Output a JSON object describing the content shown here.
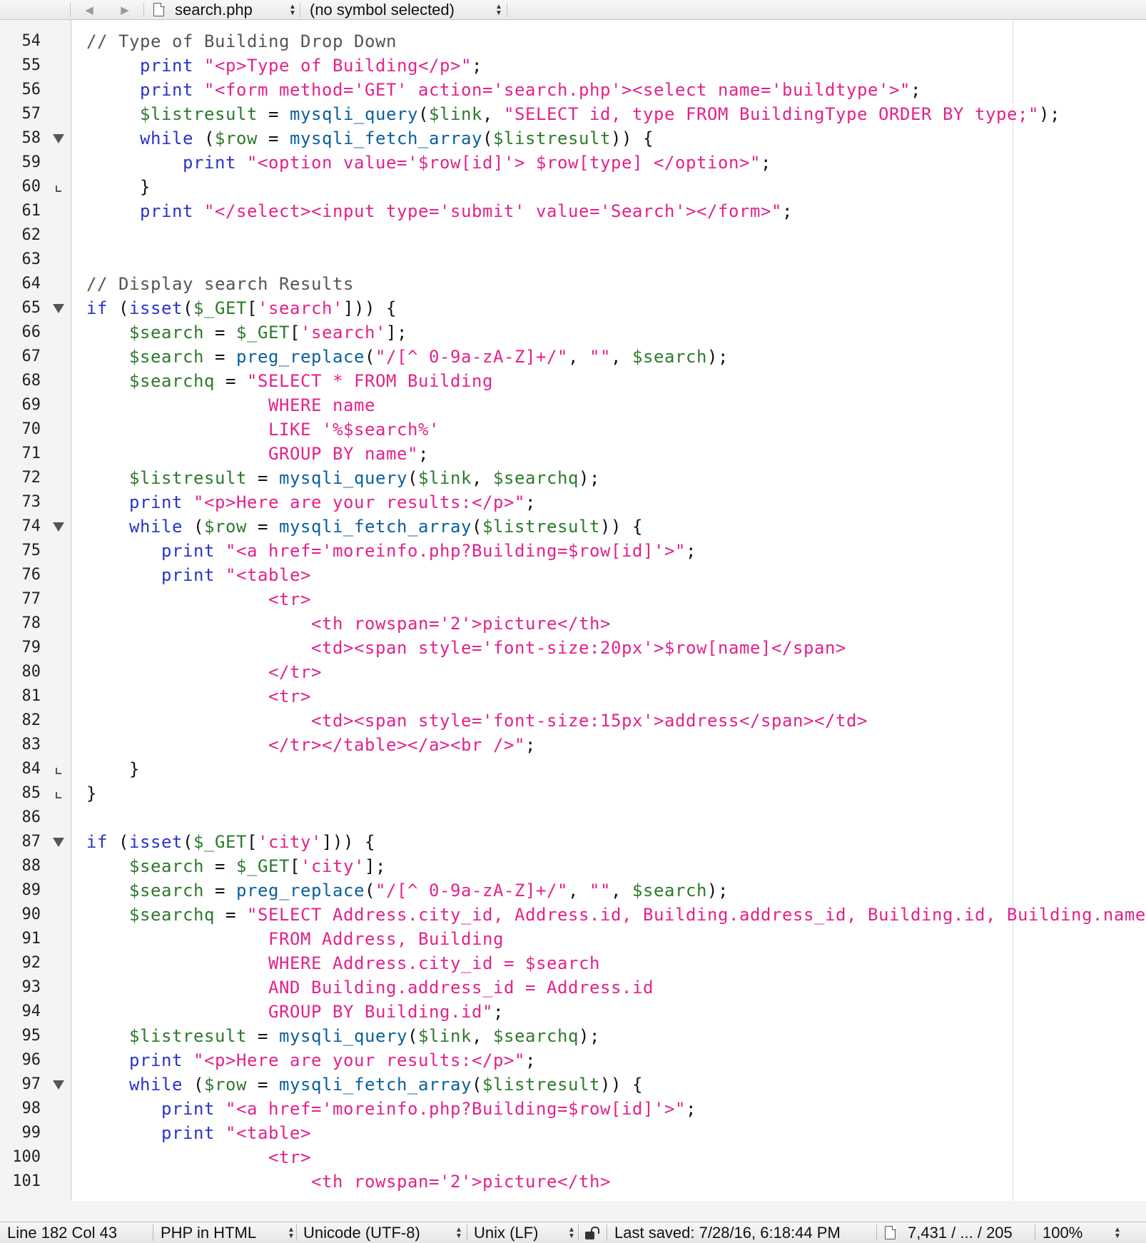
{
  "toolbar": {
    "back_glyph": "◀",
    "forward_glyph": "▶",
    "file_name": "search.php",
    "symbol_menu": "(no symbol selected)",
    "icons": [
      "back-arrow-icon",
      "forward-arrow-icon",
      "document-icon",
      "chevron-updown-icon"
    ]
  },
  "editor": {
    "lines": [
      {
        "num": "54",
        "fold": "",
        "tokens": [
          {
            "t": "// Type of Building Drop Down",
            "s": 5
          }
        ]
      },
      {
        "num": "55",
        "fold": "",
        "tokens": [
          {
            "t": "     ",
            "s": 0
          },
          {
            "t": "print",
            "s": 2
          },
          {
            "t": " ",
            "s": 0
          },
          {
            "t": "\"<p>Type of Building</p>\"",
            "s": 4
          },
          {
            "t": ";",
            "s": 0
          }
        ]
      },
      {
        "num": "56",
        "fold": "",
        "tokens": [
          {
            "t": "     ",
            "s": 0
          },
          {
            "t": "print",
            "s": 2
          },
          {
            "t": " ",
            "s": 0
          },
          {
            "t": "\"<form method='GET' action='search.php'><select name='buildtype'>\"",
            "s": 4
          },
          {
            "t": ";",
            "s": 0
          }
        ]
      },
      {
        "num": "57",
        "fold": "",
        "tokens": [
          {
            "t": "     ",
            "s": 0
          },
          {
            "t": "$listresult",
            "s": 3
          },
          {
            "t": " = ",
            "s": 0
          },
          {
            "t": "mysqli_query",
            "s": 1
          },
          {
            "t": "(",
            "s": 0
          },
          {
            "t": "$link",
            "s": 3
          },
          {
            "t": ", ",
            "s": 0
          },
          {
            "t": "\"SELECT id, type FROM BuildingType ORDER BY type;\"",
            "s": 4
          },
          {
            "t": ");",
            "s": 0
          }
        ]
      },
      {
        "num": "58",
        "fold": "open",
        "tokens": [
          {
            "t": "     ",
            "s": 0
          },
          {
            "t": "while",
            "s": 2
          },
          {
            "t": " (",
            "s": 0
          },
          {
            "t": "$row",
            "s": 3
          },
          {
            "t": " = ",
            "s": 0
          },
          {
            "t": "mysqli_fetch_array",
            "s": 1
          },
          {
            "t": "(",
            "s": 0
          },
          {
            "t": "$listresult",
            "s": 3
          },
          {
            "t": ")) {",
            "s": 0
          }
        ]
      },
      {
        "num": "59",
        "fold": "",
        "tokens": [
          {
            "t": "         ",
            "s": 0
          },
          {
            "t": "print",
            "s": 2
          },
          {
            "t": " ",
            "s": 0
          },
          {
            "t": "\"<option value='$row[id]'> $row[type] </option>\"",
            "s": 4
          },
          {
            "t": ";",
            "s": 0
          }
        ]
      },
      {
        "num": "60",
        "fold": "close",
        "tokens": [
          {
            "t": "     }",
            "s": 0
          }
        ]
      },
      {
        "num": "61",
        "fold": "",
        "tokens": [
          {
            "t": "     ",
            "s": 0
          },
          {
            "t": "print",
            "s": 2
          },
          {
            "t": " ",
            "s": 0
          },
          {
            "t": "\"</select><input type='submit' value='Search'></form>\"",
            "s": 4
          },
          {
            "t": ";",
            "s": 0
          }
        ]
      },
      {
        "num": "62",
        "fold": "",
        "tokens": []
      },
      {
        "num": "63",
        "fold": "",
        "tokens": []
      },
      {
        "num": "64",
        "fold": "",
        "tokens": [
          {
            "t": "// Display search Results",
            "s": 5
          }
        ]
      },
      {
        "num": "65",
        "fold": "open",
        "tokens": [
          {
            "t": "if",
            "s": 2
          },
          {
            "t": " (",
            "s": 0
          },
          {
            "t": "isset",
            "s": 2
          },
          {
            "t": "(",
            "s": 0
          },
          {
            "t": "$_GET",
            "s": 3
          },
          {
            "t": "[",
            "s": 0
          },
          {
            "t": "'search'",
            "s": 4
          },
          {
            "t": "])) {",
            "s": 0
          }
        ]
      },
      {
        "num": "66",
        "fold": "",
        "tokens": [
          {
            "t": "    ",
            "s": 0
          },
          {
            "t": "$search",
            "s": 3
          },
          {
            "t": " = ",
            "s": 0
          },
          {
            "t": "$_GET",
            "s": 3
          },
          {
            "t": "[",
            "s": 0
          },
          {
            "t": "'search'",
            "s": 4
          },
          {
            "t": "];",
            "s": 0
          }
        ]
      },
      {
        "num": "67",
        "fold": "",
        "tokens": [
          {
            "t": "    ",
            "s": 0
          },
          {
            "t": "$search",
            "s": 3
          },
          {
            "t": " = ",
            "s": 0
          },
          {
            "t": "preg_replace",
            "s": 1
          },
          {
            "t": "(",
            "s": 0
          },
          {
            "t": "\"/[^ 0-9a-zA-Z]+/\"",
            "s": 4
          },
          {
            "t": ", ",
            "s": 0
          },
          {
            "t": "\"\"",
            "s": 4
          },
          {
            "t": ", ",
            "s": 0
          },
          {
            "t": "$search",
            "s": 3
          },
          {
            "t": ");",
            "s": 0
          }
        ]
      },
      {
        "num": "68",
        "fold": "",
        "tokens": [
          {
            "t": "    ",
            "s": 0
          },
          {
            "t": "$searchq",
            "s": 3
          },
          {
            "t": " = ",
            "s": 0
          },
          {
            "t": "\"SELECT * FROM Building",
            "s": 4
          }
        ]
      },
      {
        "num": "69",
        "fold": "",
        "tokens": [
          {
            "t": "                 WHERE name",
            "s": 4
          }
        ]
      },
      {
        "num": "70",
        "fold": "",
        "tokens": [
          {
            "t": "                 LIKE '%$search%'",
            "s": 4
          }
        ]
      },
      {
        "num": "71",
        "fold": "",
        "tokens": [
          {
            "t": "                 GROUP BY name\"",
            "s": 4
          },
          {
            "t": ";",
            "s": 0
          }
        ]
      },
      {
        "num": "72",
        "fold": "",
        "tokens": [
          {
            "t": "    ",
            "s": 0
          },
          {
            "t": "$listresult",
            "s": 3
          },
          {
            "t": " = ",
            "s": 0
          },
          {
            "t": "mysqli_query",
            "s": 1
          },
          {
            "t": "(",
            "s": 0
          },
          {
            "t": "$link",
            "s": 3
          },
          {
            "t": ", ",
            "s": 0
          },
          {
            "t": "$searchq",
            "s": 3
          },
          {
            "t": ");",
            "s": 0
          }
        ]
      },
      {
        "num": "73",
        "fold": "",
        "tokens": [
          {
            "t": "    ",
            "s": 0
          },
          {
            "t": "print",
            "s": 2
          },
          {
            "t": " ",
            "s": 0
          },
          {
            "t": "\"<p>Here are your results:</p>\"",
            "s": 4
          },
          {
            "t": ";",
            "s": 0
          }
        ]
      },
      {
        "num": "74",
        "fold": "open",
        "tokens": [
          {
            "t": "    ",
            "s": 0
          },
          {
            "t": "while",
            "s": 2
          },
          {
            "t": " (",
            "s": 0
          },
          {
            "t": "$row",
            "s": 3
          },
          {
            "t": " = ",
            "s": 0
          },
          {
            "t": "mysqli_fetch_array",
            "s": 1
          },
          {
            "t": "(",
            "s": 0
          },
          {
            "t": "$listresult",
            "s": 3
          },
          {
            "t": ")) {",
            "s": 0
          }
        ]
      },
      {
        "num": "75",
        "fold": "",
        "tokens": [
          {
            "t": "       ",
            "s": 0
          },
          {
            "t": "print",
            "s": 2
          },
          {
            "t": " ",
            "s": 0
          },
          {
            "t": "\"<a href='moreinfo.php?Building=$row[id]'>\"",
            "s": 4
          },
          {
            "t": ";",
            "s": 0
          }
        ]
      },
      {
        "num": "76",
        "fold": "",
        "tokens": [
          {
            "t": "       ",
            "s": 0
          },
          {
            "t": "print",
            "s": 2
          },
          {
            "t": " ",
            "s": 0
          },
          {
            "t": "\"<table>",
            "s": 4
          }
        ]
      },
      {
        "num": "77",
        "fold": "",
        "tokens": [
          {
            "t": "                 <tr>",
            "s": 4
          }
        ]
      },
      {
        "num": "78",
        "fold": "",
        "tokens": [
          {
            "t": "                     <th rowspan='2'>picture</th>",
            "s": 4
          }
        ]
      },
      {
        "num": "79",
        "fold": "",
        "tokens": [
          {
            "t": "                     <td><span style='font-size:20px'>$row[name]</span>",
            "s": 4
          }
        ]
      },
      {
        "num": "80",
        "fold": "",
        "tokens": [
          {
            "t": "                 </tr>",
            "s": 4
          }
        ]
      },
      {
        "num": "81",
        "fold": "",
        "tokens": [
          {
            "t": "                 <tr>",
            "s": 4
          }
        ]
      },
      {
        "num": "82",
        "fold": "",
        "tokens": [
          {
            "t": "                     <td><span style='font-size:15px'>address</span></td>",
            "s": 4
          }
        ]
      },
      {
        "num": "83",
        "fold": "",
        "tokens": [
          {
            "t": "                 </tr></table></a><br />\"",
            "s": 4
          },
          {
            "t": ";",
            "s": 0
          }
        ]
      },
      {
        "num": "84",
        "fold": "close",
        "tokens": [
          {
            "t": "    }",
            "s": 0
          }
        ]
      },
      {
        "num": "85",
        "fold": "close",
        "tokens": [
          {
            "t": "}",
            "s": 0
          }
        ]
      },
      {
        "num": "86",
        "fold": "",
        "tokens": []
      },
      {
        "num": "87",
        "fold": "open",
        "tokens": [
          {
            "t": "if",
            "s": 2
          },
          {
            "t": " (",
            "s": 0
          },
          {
            "t": "isset",
            "s": 2
          },
          {
            "t": "(",
            "s": 0
          },
          {
            "t": "$_GET",
            "s": 3
          },
          {
            "t": "[",
            "s": 0
          },
          {
            "t": "'city'",
            "s": 4
          },
          {
            "t": "])) {",
            "s": 0
          }
        ]
      },
      {
        "num": "88",
        "fold": "",
        "tokens": [
          {
            "t": "    ",
            "s": 0
          },
          {
            "t": "$search",
            "s": 3
          },
          {
            "t": " = ",
            "s": 0
          },
          {
            "t": "$_GET",
            "s": 3
          },
          {
            "t": "[",
            "s": 0
          },
          {
            "t": "'city'",
            "s": 4
          },
          {
            "t": "];",
            "s": 0
          }
        ]
      },
      {
        "num": "89",
        "fold": "",
        "tokens": [
          {
            "t": "    ",
            "s": 0
          },
          {
            "t": "$search",
            "s": 3
          },
          {
            "t": " = ",
            "s": 0
          },
          {
            "t": "preg_replace",
            "s": 1
          },
          {
            "t": "(",
            "s": 0
          },
          {
            "t": "\"/[^ 0-9a-zA-Z]+/\"",
            "s": 4
          },
          {
            "t": ", ",
            "s": 0
          },
          {
            "t": "\"\"",
            "s": 4
          },
          {
            "t": ", ",
            "s": 0
          },
          {
            "t": "$search",
            "s": 3
          },
          {
            "t": ");",
            "s": 0
          }
        ]
      },
      {
        "num": "90",
        "fold": "",
        "tokens": [
          {
            "t": "    ",
            "s": 0
          },
          {
            "t": "$searchq",
            "s": 3
          },
          {
            "t": " = ",
            "s": 0
          },
          {
            "t": "\"SELECT Address.city_id, Address.id, Building.address_id, Building.id, Building.name",
            "s": 4
          }
        ]
      },
      {
        "num": "91",
        "fold": "",
        "tokens": [
          {
            "t": "                 FROM Address, Building",
            "s": 4
          }
        ]
      },
      {
        "num": "92",
        "fold": "",
        "tokens": [
          {
            "t": "                 WHERE Address.city_id = $search",
            "s": 4
          }
        ]
      },
      {
        "num": "93",
        "fold": "",
        "tokens": [
          {
            "t": "                 AND Building.address_id = Address.id",
            "s": 4
          }
        ]
      },
      {
        "num": "94",
        "fold": "",
        "tokens": [
          {
            "t": "                 GROUP BY Building.id\"",
            "s": 4
          },
          {
            "t": ";",
            "s": 0
          }
        ]
      },
      {
        "num": "95",
        "fold": "",
        "tokens": [
          {
            "t": "    ",
            "s": 0
          },
          {
            "t": "$listresult",
            "s": 3
          },
          {
            "t": " = ",
            "s": 0
          },
          {
            "t": "mysqli_query",
            "s": 1
          },
          {
            "t": "(",
            "s": 0
          },
          {
            "t": "$link",
            "s": 3
          },
          {
            "t": ", ",
            "s": 0
          },
          {
            "t": "$searchq",
            "s": 3
          },
          {
            "t": ");",
            "s": 0
          }
        ]
      },
      {
        "num": "96",
        "fold": "",
        "tokens": [
          {
            "t": "    ",
            "s": 0
          },
          {
            "t": "print",
            "s": 2
          },
          {
            "t": " ",
            "s": 0
          },
          {
            "t": "\"<p>Here are your results:</p>\"",
            "s": 4
          },
          {
            "t": ";",
            "s": 0
          }
        ]
      },
      {
        "num": "97",
        "fold": "open",
        "tokens": [
          {
            "t": "    ",
            "s": 0
          },
          {
            "t": "while",
            "s": 2
          },
          {
            "t": " (",
            "s": 0
          },
          {
            "t": "$row",
            "s": 3
          },
          {
            "t": " = ",
            "s": 0
          },
          {
            "t": "mysqli_fetch_array",
            "s": 1
          },
          {
            "t": "(",
            "s": 0
          },
          {
            "t": "$listresult",
            "s": 3
          },
          {
            "t": ")) {",
            "s": 0
          }
        ]
      },
      {
        "num": "98",
        "fold": "",
        "tokens": [
          {
            "t": "       ",
            "s": 0
          },
          {
            "t": "print",
            "s": 2
          },
          {
            "t": " ",
            "s": 0
          },
          {
            "t": "\"<a href='moreinfo.php?Building=$row[id]'>\"",
            "s": 4
          },
          {
            "t": ";",
            "s": 0
          }
        ]
      },
      {
        "num": "99",
        "fold": "",
        "tokens": [
          {
            "t": "       ",
            "s": 0
          },
          {
            "t": "print",
            "s": 2
          },
          {
            "t": " ",
            "s": 0
          },
          {
            "t": "\"<table>",
            "s": 4
          }
        ]
      },
      {
        "num": "100",
        "fold": "",
        "tokens": [
          {
            "t": "                 <tr>",
            "s": 4
          }
        ]
      },
      {
        "num": "101",
        "fold": "",
        "tokens": [
          {
            "t": "                     <th rowspan='2'>picture</th>",
            "s": 4
          }
        ]
      }
    ]
  },
  "statusbar": {
    "position": "Line 182 Col 43",
    "language": "PHP in HTML",
    "encoding": "Unicode (UTF-8)",
    "line_endings": "Unix (LF)",
    "last_saved": "Last saved: 7/28/16, 6:18:44 PM",
    "doc_stats": "7,431 / ... / 205",
    "zoom": "100%"
  }
}
